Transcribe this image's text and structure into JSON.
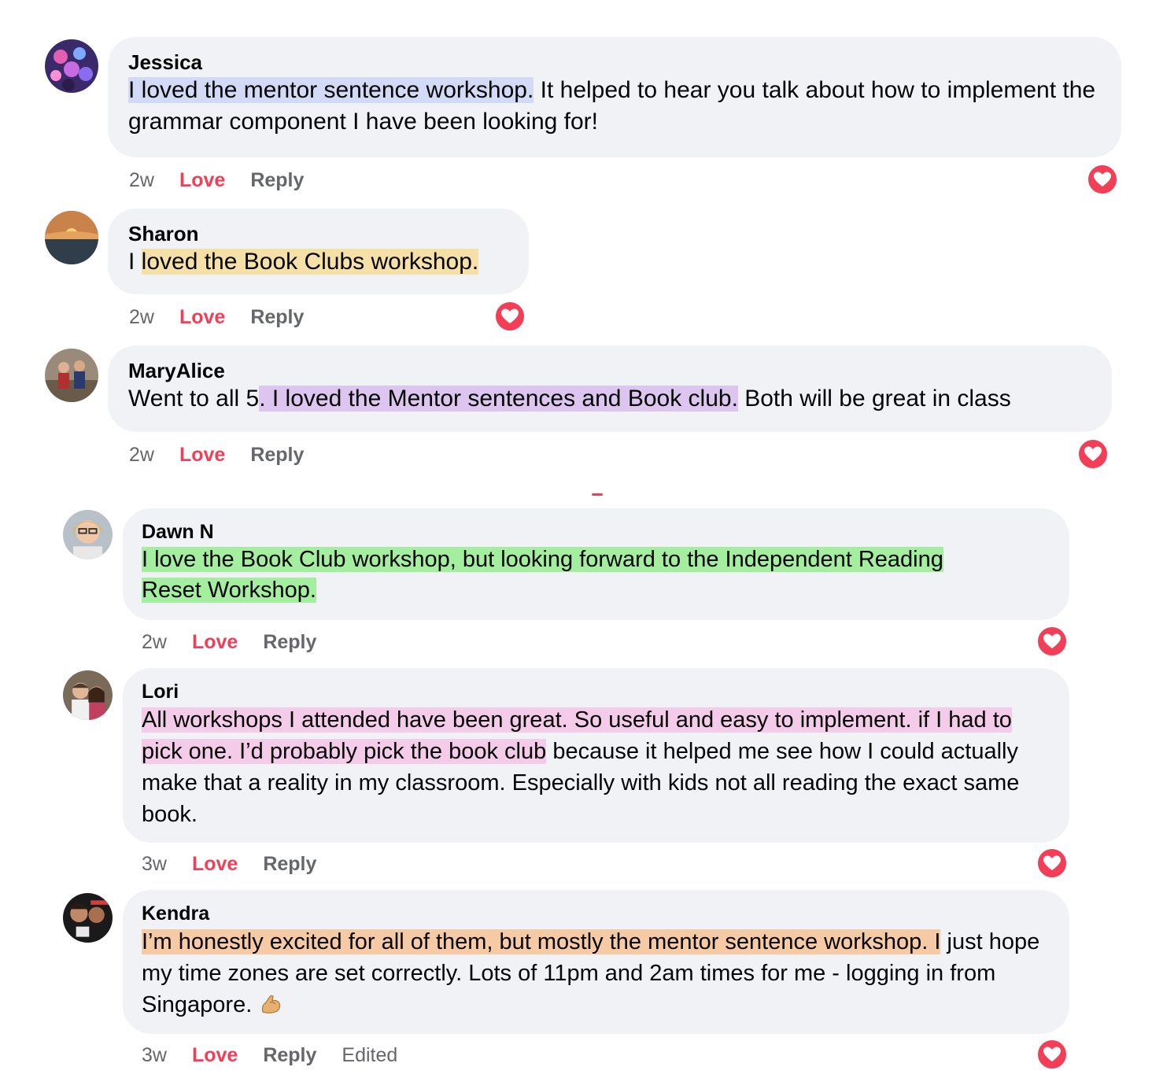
{
  "comments": [
    {
      "name": "Jessica",
      "segments": [
        {
          "text": "I loved the mentor sentence workshop.",
          "hl": "blue"
        },
        {
          "text": " It helped to hear you talk about how to implement the grammar component I have been looking for!",
          "hl": ""
        }
      ],
      "time": "2w",
      "love": "Love",
      "reply": "Reply"
    },
    {
      "name": "Sharon",
      "segments": [
        {
          "text": "I ",
          "hl": ""
        },
        {
          "text": "loved the Book Clubs workshop.",
          "hl": "yellow"
        }
      ],
      "time": "2w",
      "love": "Love",
      "reply": "Reply"
    },
    {
      "name": "MaryAlice",
      "segments": [
        {
          "text": "Went to all 5",
          "hl": ""
        },
        {
          "text": ". I loved the Mentor sentences and Book club.",
          "hl": "purple"
        },
        {
          "text": " Both will be great in class",
          "hl": ""
        }
      ],
      "time": "2w",
      "love": "Love",
      "reply": "Reply"
    },
    {
      "name": "Dawn N",
      "segments": [
        {
          "text": "I love the Book Club workshop, but looking forward to the Independent Reading Reset Workshop.",
          "hl": "green"
        }
      ],
      "time": "2w",
      "love": "Love",
      "reply": "Reply"
    },
    {
      "name": "Lori",
      "segments": [
        {
          "text": "All workshops I attended have been great. So useful and easy to implement. if I had to pick one. I’d probably pick the book club",
          "hl": "pink"
        },
        {
          "text": " because it helped me see how I could actually make that a reality in my classroom. Especially with kids not all reading the exact same book.",
          "hl": ""
        }
      ],
      "time": "3w",
      "love": "Love",
      "reply": "Reply"
    },
    {
      "name": "Kendra",
      "segments": [
        {
          "text": "I’m honestly excited for all of them, but mostly the mentor sentence workshop. I",
          "hl": "orange"
        },
        {
          "text": " just hope my time zones are set correctly. Lots of 11pm and 2am times for me - logging in from Singapore. ",
          "hl": ""
        }
      ],
      "emoji": "flexed-biceps-icon",
      "time": "3w",
      "love": "Love",
      "reply": "Reply",
      "edited": "Edited"
    }
  ],
  "colors": {
    "bubble": "#f0f2f5",
    "love": "#f33e58",
    "meta": "#65676b",
    "hl_blue": "#d3daf5",
    "hl_yellow": "#f5e0a8",
    "hl_purple": "#dcc6ef",
    "hl_green": "#a4ef9f",
    "hl_pink": "#f4cbe9",
    "hl_orange": "#f6caa4"
  }
}
